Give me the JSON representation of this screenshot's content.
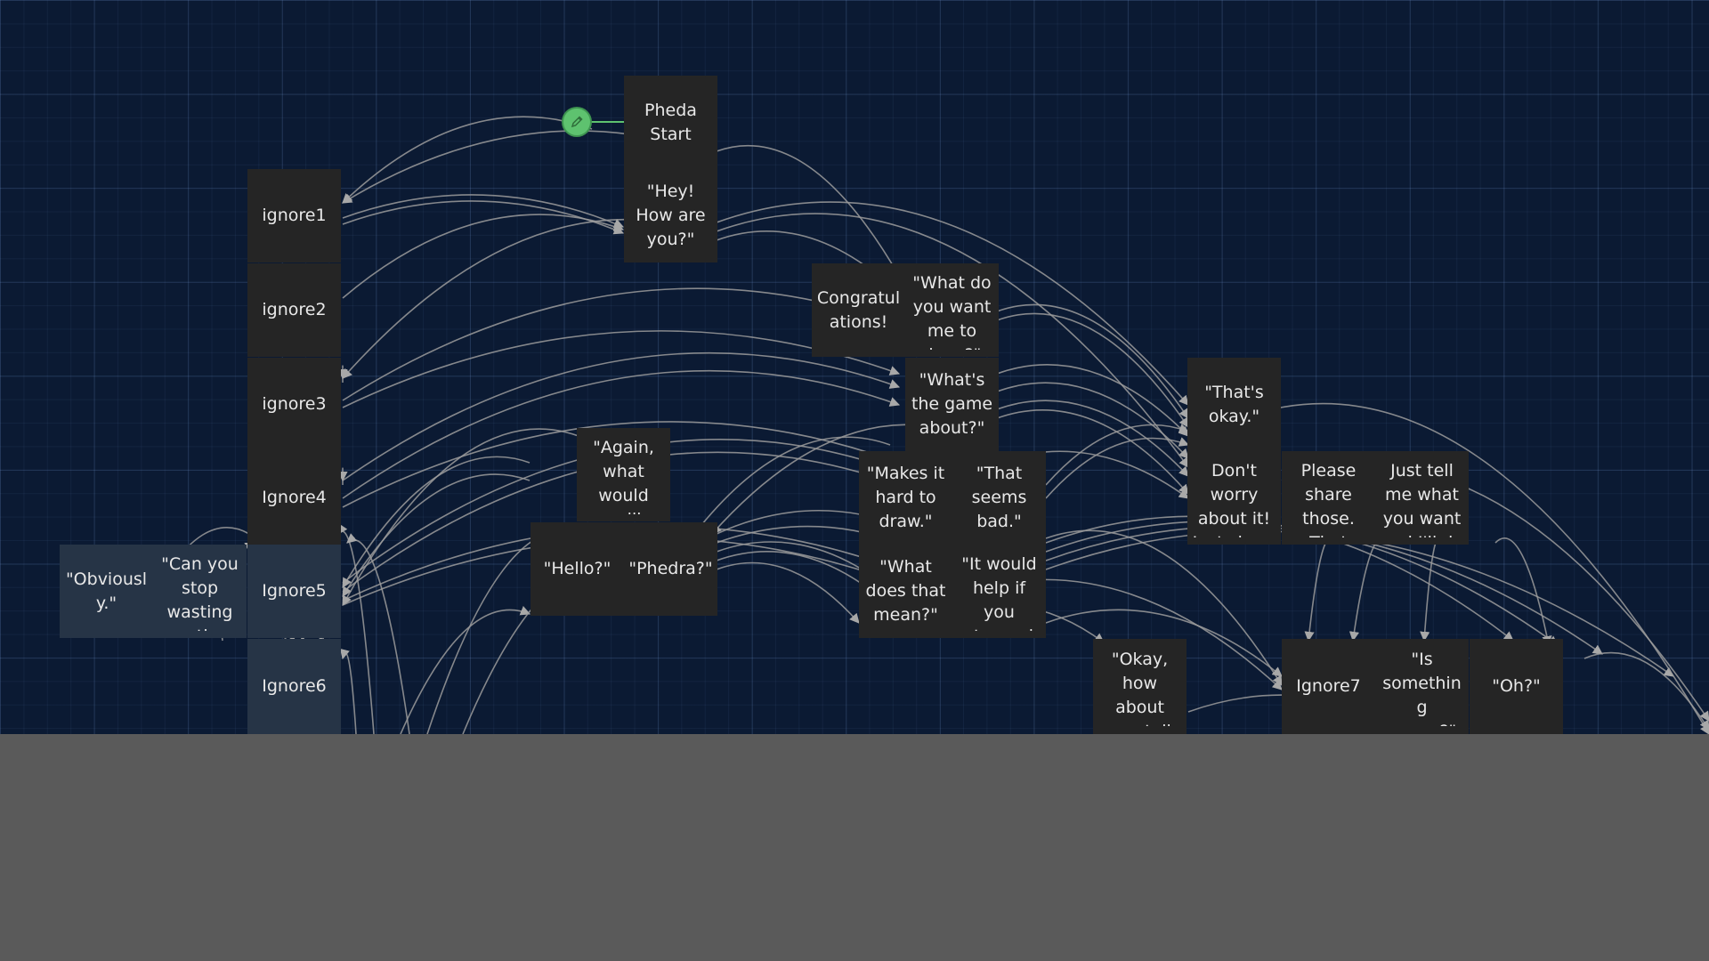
{
  "graph": {
    "nodes": [
      {
        "id": "pheda-start",
        "label": "Pheda Start"
      },
      {
        "id": "hey",
        "label": "\"Hey! How are you?\""
      },
      {
        "id": "ignore1",
        "label": "ignore1"
      },
      {
        "id": "ignore2",
        "label": "ignore2"
      },
      {
        "id": "ignore3",
        "label": "ignore3"
      },
      {
        "id": "ignore4",
        "label": "Ignore4"
      },
      {
        "id": "ignore5",
        "label": "Ignore5"
      },
      {
        "id": "ignore6",
        "label": "Ignore6"
      },
      {
        "id": "obviously",
        "label": "\"Obviously.\""
      },
      {
        "id": "can-you-stop",
        "label": "\"Can you stop wasting my time"
      },
      {
        "id": "again",
        "label": "\"Again, what would you like"
      },
      {
        "id": "hello",
        "label": "\"Hello?\""
      },
      {
        "id": "phedra",
        "label": "\"Phedra?\""
      },
      {
        "id": "congrats",
        "label": "Congratulations!"
      },
      {
        "id": "what-draw",
        "label": "\"What do you want me to draw?\""
      },
      {
        "id": "game-about",
        "label": "\"What's the game about?\""
      },
      {
        "id": "hard-draw",
        "label": "\"Makes it hard to draw.\""
      },
      {
        "id": "seems-bad",
        "label": "\"That seems bad.\""
      },
      {
        "id": "what-mean",
        "label": "\"What does that mean?\""
      },
      {
        "id": "would-help",
        "label": "\"It would help if you stopped"
      },
      {
        "id": "thats-okay",
        "label": "\"That's okay.\""
      },
      {
        "id": "dont-worry",
        "label": "Don't worry about it! Just share"
      },
      {
        "id": "please-share",
        "label": "Please share those. That"
      },
      {
        "id": "just-tell",
        "label": "Just tell me what you want and I'll do"
      },
      {
        "id": "okay-how",
        "label": "\"Okay, how about you tell me"
      },
      {
        "id": "ignore7",
        "label": "Ignore7"
      },
      {
        "id": "something-wrong",
        "label": "\"Is something wrong?\""
      },
      {
        "id": "oh",
        "label": "\"Oh?\""
      }
    ]
  },
  "icons": {
    "start": "pencil-icon"
  },
  "colors": {
    "canvas": "#0b1a33",
    "node": "#252525",
    "selected_node": "#263446",
    "link": "#a0a0a0",
    "start": "#5ec26f",
    "panel": "#5a5a5a"
  }
}
